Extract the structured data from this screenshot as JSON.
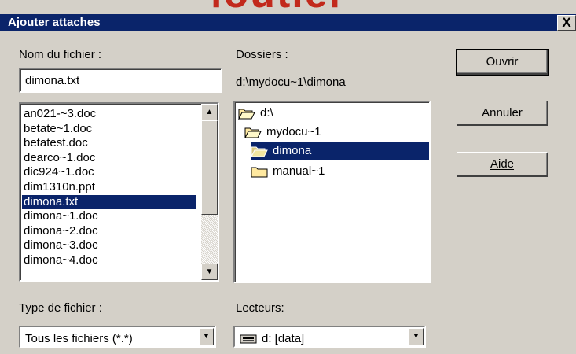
{
  "background_logo": "loutiel",
  "window": {
    "title": "Ajouter attaches",
    "close_label": "X"
  },
  "filename": {
    "label": "Nom du fichier :",
    "value": "dimona.txt"
  },
  "file_list": [
    "an021-~3.doc",
    "betate~1.doc",
    "betatest.doc",
    "dearco~1.doc",
    "dic924~1.doc",
    "dim1310n.ppt",
    "dimona.txt",
    "dimona~1.doc",
    "dimona~2.doc",
    "dimona~3.doc",
    "dimona~4.doc"
  ],
  "selected_file": "dimona.txt",
  "folders": {
    "label": "Dossiers :",
    "path": "d:\\mydocu~1\\dimona",
    "items": [
      "d:\\",
      "mydocu~1",
      "dimona",
      "manual~1"
    ],
    "selected": "dimona"
  },
  "buttons": {
    "open": "Ouvrir",
    "cancel": "Annuler",
    "help": "Aide"
  },
  "file_type": {
    "label": "Type de fichier :",
    "value": "Tous les fichiers (*.*)"
  },
  "drives": {
    "label": "Lecteurs:",
    "value": "d: [data]"
  },
  "colors": {
    "titlebar": "#0a246a",
    "face": "#d4d0c8",
    "selection": "#0a246a"
  },
  "icons": [
    "close-icon",
    "scroll-up-icon",
    "scroll-down-icon",
    "folder-open-icon",
    "folder-icon",
    "drive-icon",
    "dropdown-arrow-icon"
  ]
}
